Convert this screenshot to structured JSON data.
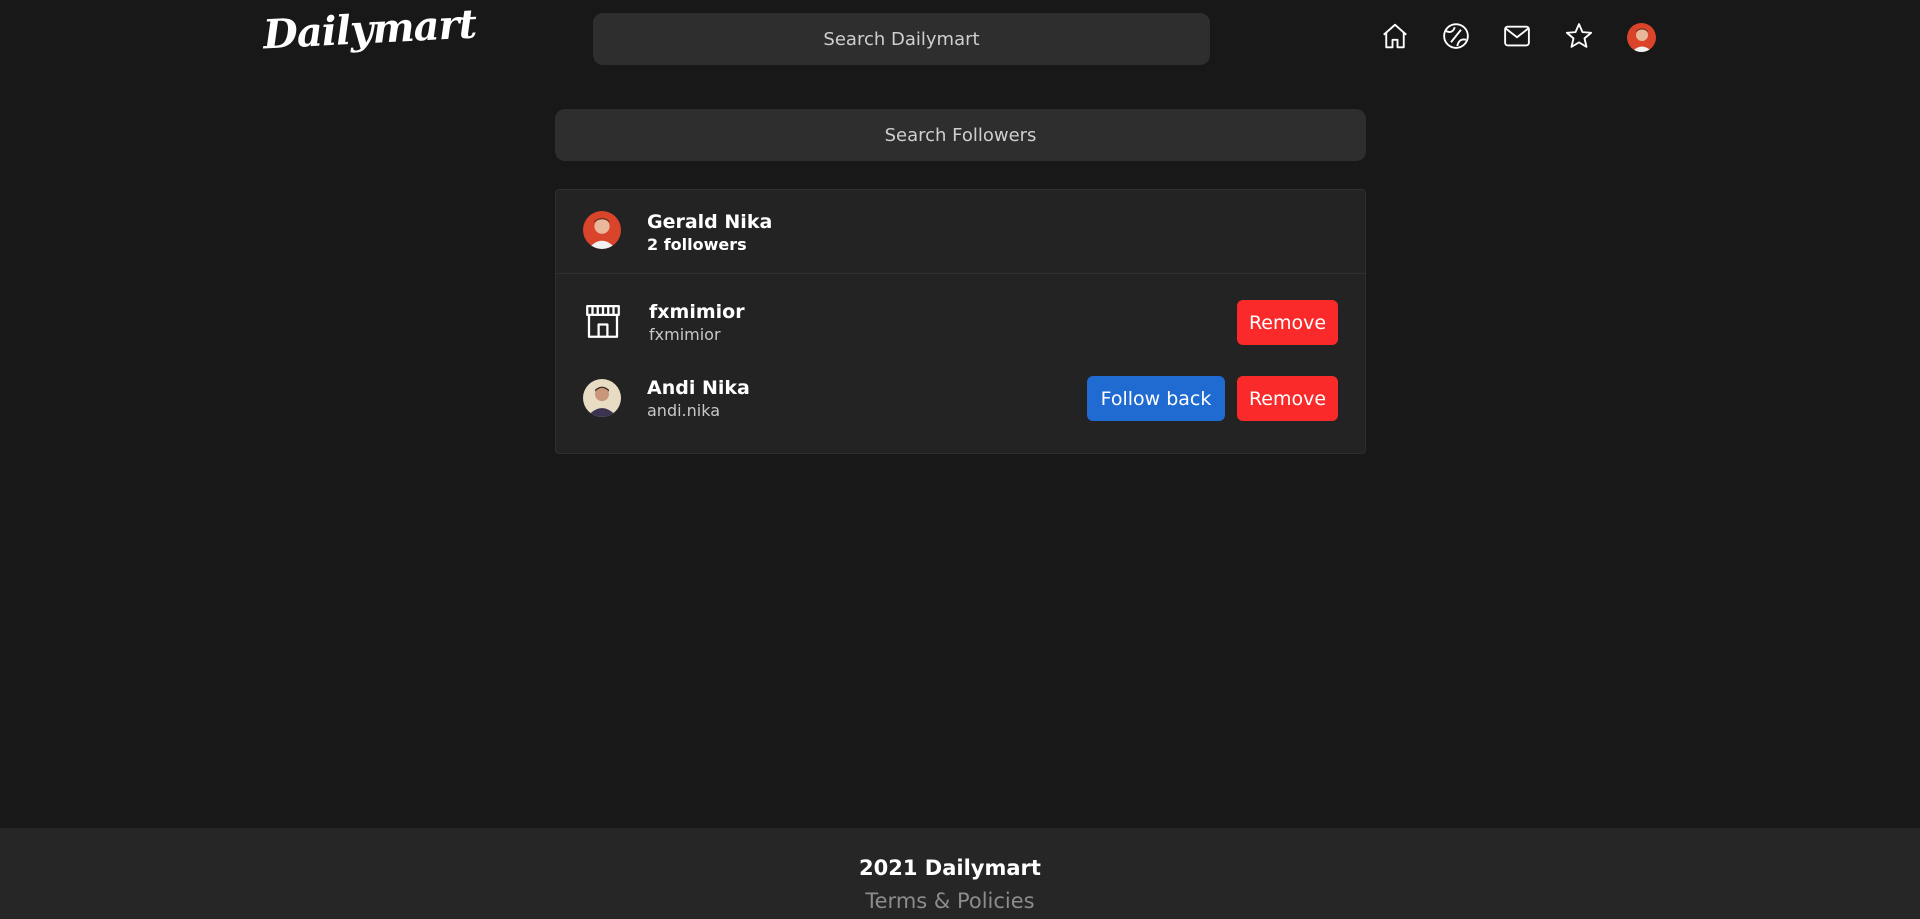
{
  "header": {
    "logo": "Dailymart",
    "search_placeholder": "Search Dailymart",
    "nav_icons": [
      "home-icon",
      "explore-icon",
      "mail-icon",
      "star-icon",
      "profile-avatar"
    ]
  },
  "main": {
    "search_placeholder": "Search Followers",
    "owner": {
      "name": "Gerald Nika",
      "followers": "2 followers"
    },
    "followers": [
      {
        "name": "fxmimior",
        "handle": "fxmimior",
        "icon": "store-icon",
        "remove_label": "Remove"
      },
      {
        "name": "Andi Nika",
        "handle": "andi.nika",
        "follow_back_label": "Follow back",
        "remove_label": "Remove"
      }
    ]
  },
  "footer": {
    "copyright": "2021 Dailymart",
    "link": "Terms & Policies"
  },
  "colors": {
    "background": "#181818",
    "panel": "#232323",
    "input": "#2e2e2e",
    "remove": "#fb2a2a",
    "follow_back": "#1f6bd1",
    "footer": "#262626"
  }
}
